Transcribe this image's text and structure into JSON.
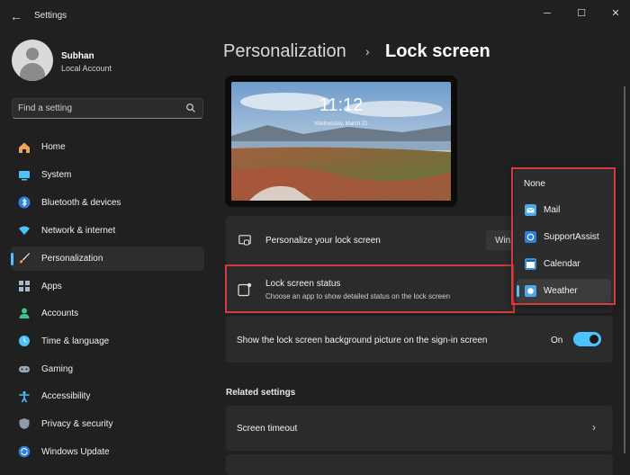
{
  "window": {
    "title": "Settings",
    "minimize": "─",
    "maximize": "☐",
    "close": "✕",
    "back": "←"
  },
  "user": {
    "name": "Subhan",
    "account": "Local Account"
  },
  "search": {
    "placeholder": "Find a setting"
  },
  "sidebar": {
    "items": [
      {
        "label": "Home",
        "icon": "home-icon"
      },
      {
        "label": "System",
        "icon": "system-icon"
      },
      {
        "label": "Bluetooth & devices",
        "icon": "bluetooth-icon"
      },
      {
        "label": "Network & internet",
        "icon": "wifi-icon"
      },
      {
        "label": "Personalization",
        "icon": "brush-icon",
        "active": true
      },
      {
        "label": "Apps",
        "icon": "apps-icon"
      },
      {
        "label": "Accounts",
        "icon": "accounts-icon"
      },
      {
        "label": "Time & language",
        "icon": "globe-clock-icon"
      },
      {
        "label": "Gaming",
        "icon": "gamepad-icon"
      },
      {
        "label": "Accessibility",
        "icon": "accessibility-icon"
      },
      {
        "label": "Privacy & security",
        "icon": "shield-icon"
      },
      {
        "label": "Windows Update",
        "icon": "update-icon"
      }
    ]
  },
  "breadcrumb": {
    "parent": "Personalization",
    "separator": "›",
    "current": "Lock screen"
  },
  "preview": {
    "time": "11:12",
    "date": "Wednesday, March 22"
  },
  "settings": {
    "personalize": {
      "label": "Personalize your lock screen",
      "value": "Win"
    },
    "status": {
      "label": "Lock screen status",
      "description": "Choose an app to show detailed status on the lock screen"
    },
    "background": {
      "label": "Show the lock screen background picture on the sign-in screen",
      "state": "On"
    }
  },
  "related": {
    "heading": "Related settings",
    "screen_timeout": "Screen timeout",
    "chevron": "›"
  },
  "popup": {
    "options": [
      {
        "label": "None",
        "icon": ""
      },
      {
        "label": "Mail",
        "icon": "mail-icon"
      },
      {
        "label": "SupportAssist",
        "icon": "supportassist-icon"
      },
      {
        "label": "Calendar",
        "icon": "calendar-icon"
      },
      {
        "label": "Weather",
        "icon": "weather-icon",
        "selected": true
      }
    ]
  },
  "colors": {
    "accent": "#4cc2ff",
    "highlight": "#d63a3a",
    "background": "#202020",
    "card": "#2b2b2b"
  }
}
